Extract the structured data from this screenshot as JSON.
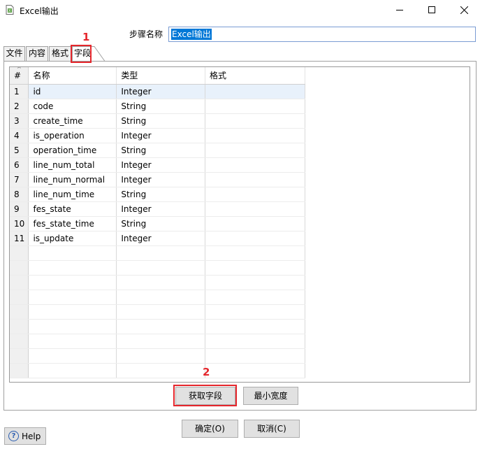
{
  "window": {
    "title": "Excel输出",
    "icon": "document-icon"
  },
  "step": {
    "label": "步骤名称",
    "value": "Excel输出"
  },
  "tabs": [
    {
      "label": "文件"
    },
    {
      "label": "内容"
    },
    {
      "label": "格式"
    },
    {
      "label": "字段",
      "active": true
    }
  ],
  "table": {
    "headers": [
      "#",
      "名称",
      "类型",
      "格式"
    ],
    "rows": [
      {
        "num": "1",
        "name": "id",
        "type": "Integer",
        "format": ""
      },
      {
        "num": "2",
        "name": "code",
        "type": "String",
        "format": ""
      },
      {
        "num": "3",
        "name": "create_time",
        "type": "String",
        "format": ""
      },
      {
        "num": "4",
        "name": "is_operation",
        "type": "Integer",
        "format": ""
      },
      {
        "num": "5",
        "name": "operation_time",
        "type": "String",
        "format": ""
      },
      {
        "num": "6",
        "name": "line_num_total",
        "type": "Integer",
        "format": ""
      },
      {
        "num": "7",
        "name": "line_num_normal",
        "type": "Integer",
        "format": ""
      },
      {
        "num": "8",
        "name": "line_num_time",
        "type": "String",
        "format": ""
      },
      {
        "num": "9",
        "name": "fes_state",
        "type": "Integer",
        "format": ""
      },
      {
        "num": "10",
        "name": "fes_state_time",
        "type": "String",
        "format": ""
      },
      {
        "num": "11",
        "name": "is_update",
        "type": "Integer",
        "format": ""
      }
    ]
  },
  "buttons": {
    "get_fields": "获取字段",
    "min_width": "最小宽度",
    "ok": "确定(O)",
    "cancel": "取消(C)",
    "help": "Help"
  },
  "annotations": {
    "mark1": "1",
    "mark2": "2",
    "color": "#e5262c"
  }
}
